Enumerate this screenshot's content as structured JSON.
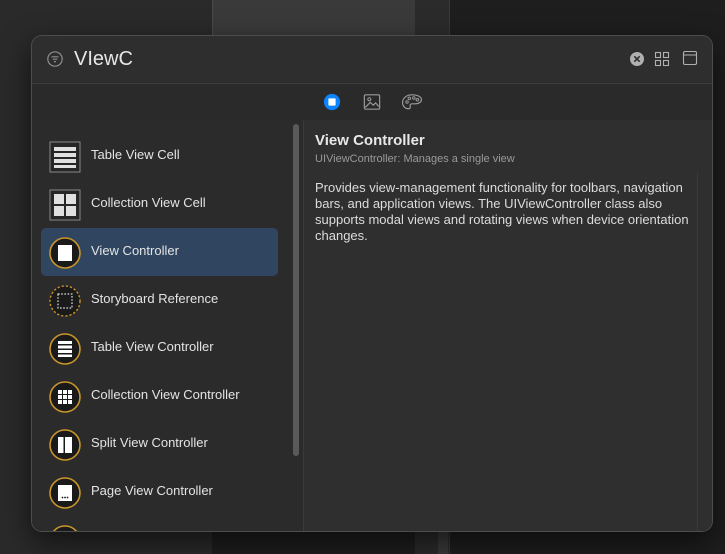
{
  "search": {
    "value": "VIewC"
  },
  "tabs": [
    {
      "icon": "objects-library-icon",
      "selected": true
    },
    {
      "icon": "media-library-icon",
      "selected": false
    },
    {
      "icon": "color-palette-icon",
      "selected": false
    }
  ],
  "library_items": [
    {
      "label": "Table View Cell",
      "icon": "table-view-cell-icon",
      "selected": false
    },
    {
      "label": "Collection View Cell",
      "icon": "collection-view-cell-icon",
      "selected": false
    },
    {
      "label": "View Controller",
      "icon": "view-controller-icon",
      "selected": true
    },
    {
      "label": "Storyboard Reference",
      "icon": "storyboard-reference-icon",
      "selected": false
    },
    {
      "label": "Table View Controller",
      "icon": "table-view-controller-icon",
      "selected": false
    },
    {
      "label": "Collection View Controller",
      "icon": "collection-view-controller-icon",
      "selected": false
    },
    {
      "label": "Split View Controller",
      "icon": "split-view-controller-icon",
      "selected": false
    },
    {
      "label": "Page View Controller",
      "icon": "page-view-controller-icon",
      "selected": false
    }
  ],
  "detail": {
    "title": "View Controller",
    "subtitle": "UIViewController: Manages a single view",
    "description": "Provides view-management functionality for toolbars, navigation bars, and application views. The UIViewController class also supports modal views and rotating views when device orientation changes."
  },
  "colors": {
    "accent": "#0a84ff",
    "selection": "#304660",
    "controller_ring": "#c8952a"
  }
}
